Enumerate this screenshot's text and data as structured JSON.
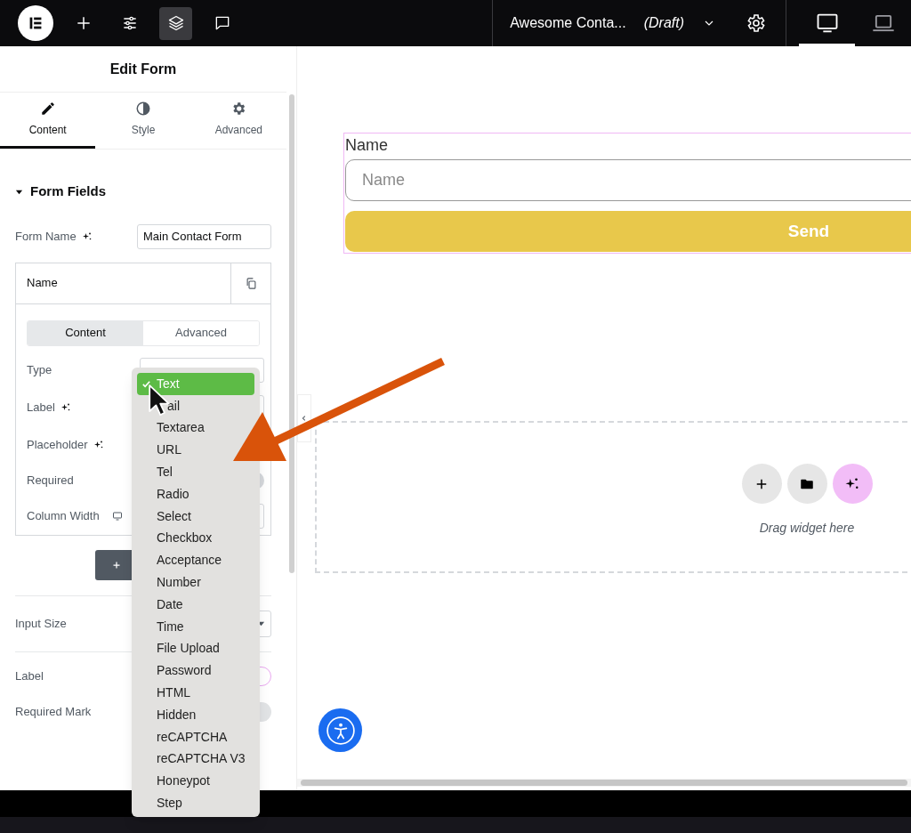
{
  "topbar": {
    "tools": [
      {
        "kind": "add",
        "selected": false
      },
      {
        "kind": "settings",
        "selected": false
      },
      {
        "kind": "layers",
        "selected": true
      },
      {
        "kind": "comments",
        "selected": false
      }
    ],
    "page_title": "Awesome Conta...",
    "status": "(Draft)",
    "devices": [
      {
        "kind": "desktop",
        "selected": true
      },
      {
        "kind": "laptop",
        "selected": false
      }
    ]
  },
  "panel": {
    "title": "Edit Form",
    "tabs": [
      {
        "label": "Content",
        "kind": "pencil",
        "selected": true
      },
      {
        "label": "Style",
        "kind": "contrast",
        "selected": false
      },
      {
        "label": "Advanced",
        "kind": "gear",
        "selected": false
      }
    ],
    "section": {
      "title": "Form Fields",
      "expanded": true
    },
    "form_name": {
      "label": "Form Name",
      "value": "Main Contact Form"
    },
    "field_item": {
      "title": "Name",
      "subtabs": [
        {
          "label": "Content",
          "selected": true
        },
        {
          "label": "Advanced",
          "selected": false
        }
      ],
      "rows": [
        {
          "label": "Type",
          "kind": "select",
          "ai": false
        },
        {
          "label": "Label",
          "kind": "text",
          "ai": true
        },
        {
          "label": "Placeholder",
          "kind": "text",
          "ai": true
        },
        {
          "label": "Required",
          "kind": "toggle",
          "ai": false,
          "on": false
        },
        {
          "label": "Column Width",
          "kind": "responsive-select",
          "ai": false
        }
      ]
    },
    "settings": [
      {
        "label": "Input Size",
        "kind": "select"
      },
      {
        "label": "Label",
        "kind": "toggle-outline",
        "on": false
      },
      {
        "label": "Required Mark",
        "kind": "toggle",
        "on": false
      }
    ]
  },
  "dropdown": {
    "options": [
      {
        "label": "Text",
        "selected": true
      },
      {
        "label": "ail",
        "selected": false,
        "covered": true
      },
      {
        "label": "Textarea",
        "selected": false
      },
      {
        "label": "URL",
        "selected": false
      },
      {
        "label": "Tel",
        "selected": false
      },
      {
        "label": "Radio",
        "selected": false
      },
      {
        "label": "Select",
        "selected": false
      },
      {
        "label": "Checkbox",
        "selected": false
      },
      {
        "label": "Acceptance",
        "selected": false
      },
      {
        "label": "Number",
        "selected": false
      },
      {
        "label": "Date",
        "selected": false
      },
      {
        "label": "Time",
        "selected": false
      },
      {
        "label": "File Upload",
        "selected": false
      },
      {
        "label": "Password",
        "selected": false
      },
      {
        "label": "HTML",
        "selected": false
      },
      {
        "label": "Hidden",
        "selected": false
      },
      {
        "label": "reCAPTCHA",
        "selected": false
      },
      {
        "label": "reCAPTCHA V3",
        "selected": false
      },
      {
        "label": "Honeypot",
        "selected": false
      },
      {
        "label": "Step",
        "selected": false
      }
    ]
  },
  "canvas": {
    "form": {
      "label": "Name",
      "placeholder": "Name",
      "button": "Send"
    },
    "empty_section": {
      "hint": "Drag widget here"
    }
  }
}
